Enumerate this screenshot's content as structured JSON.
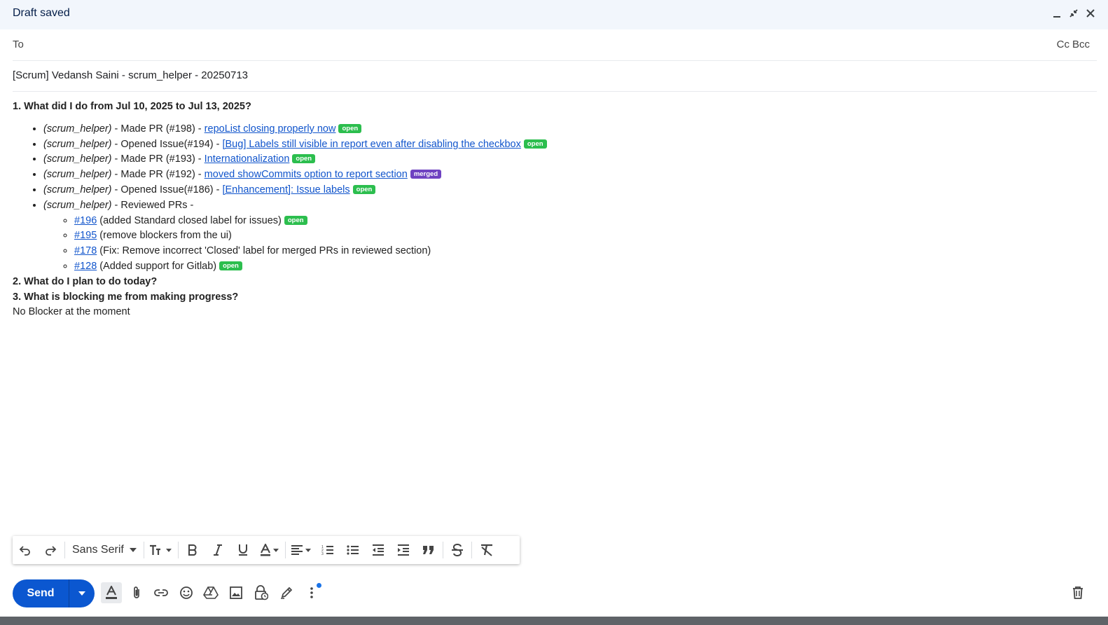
{
  "window": {
    "title": "Draft saved"
  },
  "to": {
    "label": "To",
    "cc": "Cc",
    "bcc": "Bcc"
  },
  "subject": "[Scrum] Vedansh Saini - scrum_helper - 20250713",
  "body": {
    "q1": "1. What did I do from Jul 10, 2025 to Jul 13, 2025?",
    "items": [
      {
        "repo": "(scrum_helper)",
        "text": " - Made PR (#198) - ",
        "link": "repoList closing properly now",
        "badge": "open"
      },
      {
        "repo": "(scrum_helper)",
        "text": " - Opened Issue(#194) - ",
        "link": "[Bug] Labels still visible in report even after disabling the checkbox",
        "badge": "open"
      },
      {
        "repo": "(scrum_helper)",
        "text": " - Made PR (#193) - ",
        "link": "Internationalization",
        "badge": "open"
      },
      {
        "repo": "(scrum_helper)",
        "text": " - Made PR (#192) - ",
        "link": "moved showCommits option to report section",
        "badge": "merged"
      },
      {
        "repo": "(scrum_helper)",
        "text": " - Opened Issue(#186) - ",
        "link": "[Enhancement]: Issue labels",
        "badge": "open"
      }
    ],
    "reviewed": {
      "repo": "(scrum_helper)",
      "text": " - Reviewed PRs -"
    },
    "reviewed_items": [
      {
        "link": "#196",
        "text": " (added Standard closed label for issues)",
        "badge": "open"
      },
      {
        "link": "#195",
        "text": " (remove blockers from the ui)",
        "badge": ""
      },
      {
        "link": "#178",
        "text": " (Fix: Remove incorrect 'Closed' label for merged PRs in reviewed section)",
        "badge": ""
      },
      {
        "link": "#128",
        "text": " (Added support for Gitlab)",
        "badge": "open"
      }
    ],
    "q2": "2. What do I plan to do today?",
    "q3": "3. What is blocking me from making progress?",
    "blocker": "No Blocker at the moment"
  },
  "format": {
    "font": "Sans Serif"
  },
  "actions": {
    "send": "Send"
  },
  "colors": {
    "accent": "#0b57d0",
    "open_badge": "#2cbe4e",
    "merged_badge": "#6f42c1",
    "link": "#1155cc"
  }
}
